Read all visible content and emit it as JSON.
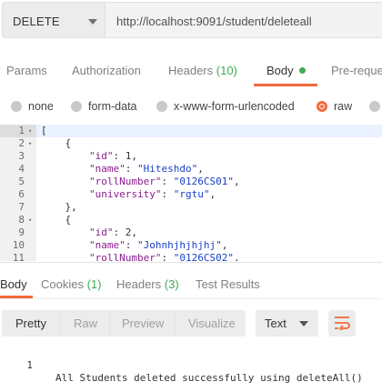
{
  "request": {
    "method": "DELETE",
    "url": "http://localhost:9091/student/deleteall"
  },
  "request_tabs": {
    "params": "Params",
    "authorization": "Authorization",
    "headers": "Headers",
    "headers_count": "(10)",
    "body": "Body",
    "prerequest": "Pre-reque"
  },
  "body_types": {
    "none": "none",
    "form_data": "form-data",
    "urlencoded": "x-www-form-urlencoded",
    "raw": "raw",
    "selected": "raw"
  },
  "editor": {
    "lines": [
      {
        "n": "1",
        "fold": "▾"
      },
      {
        "n": "2",
        "fold": "▾"
      },
      {
        "n": "3",
        "key": "\"id\"",
        "val": "1",
        "kind": "num"
      },
      {
        "n": "4",
        "key": "\"name\"",
        "val": "\"Hiteshdo\"",
        "kind": "str"
      },
      {
        "n": "5",
        "key": "\"rollNumber\"",
        "val": "\"0126CS01\"",
        "kind": "str"
      },
      {
        "n": "6",
        "key": "\"university\"",
        "val": "\"rgtu\"",
        "kind": "str"
      },
      {
        "n": "7",
        "text": "},"
      },
      {
        "n": "8",
        "fold": "▾",
        "text": "{"
      },
      {
        "n": "9",
        "key": "\"id\"",
        "val": "2",
        "kind": "num"
      },
      {
        "n": "10",
        "key": "\"name\"",
        "val": "\"Johnhjhjhjhj\"",
        "kind": "str"
      },
      {
        "n": "11",
        "key": "\"rollNumber\"",
        "val": "\"0126CS02\"",
        "kind": "str"
      }
    ]
  },
  "response_tabs": {
    "body": "Body",
    "cookies": "Cookies",
    "cookies_count": "(1)",
    "headers": "Headers",
    "headers_count": "(3)",
    "test_results": "Test Results"
  },
  "response_toolbar": {
    "pretty": "Pretty",
    "raw": "Raw",
    "preview": "Preview",
    "visualize": "Visualize",
    "format": "Text",
    "wrap_icon": "wrap-lines-icon"
  },
  "response_body": {
    "line_number": "1",
    "text": "All Students deleted successfully using deleteAll()"
  },
  "colors": {
    "accent": "#f26b3a",
    "green": "#3fab53",
    "json_key": "#8a1c8e",
    "json_string": "#1a3fc4"
  }
}
